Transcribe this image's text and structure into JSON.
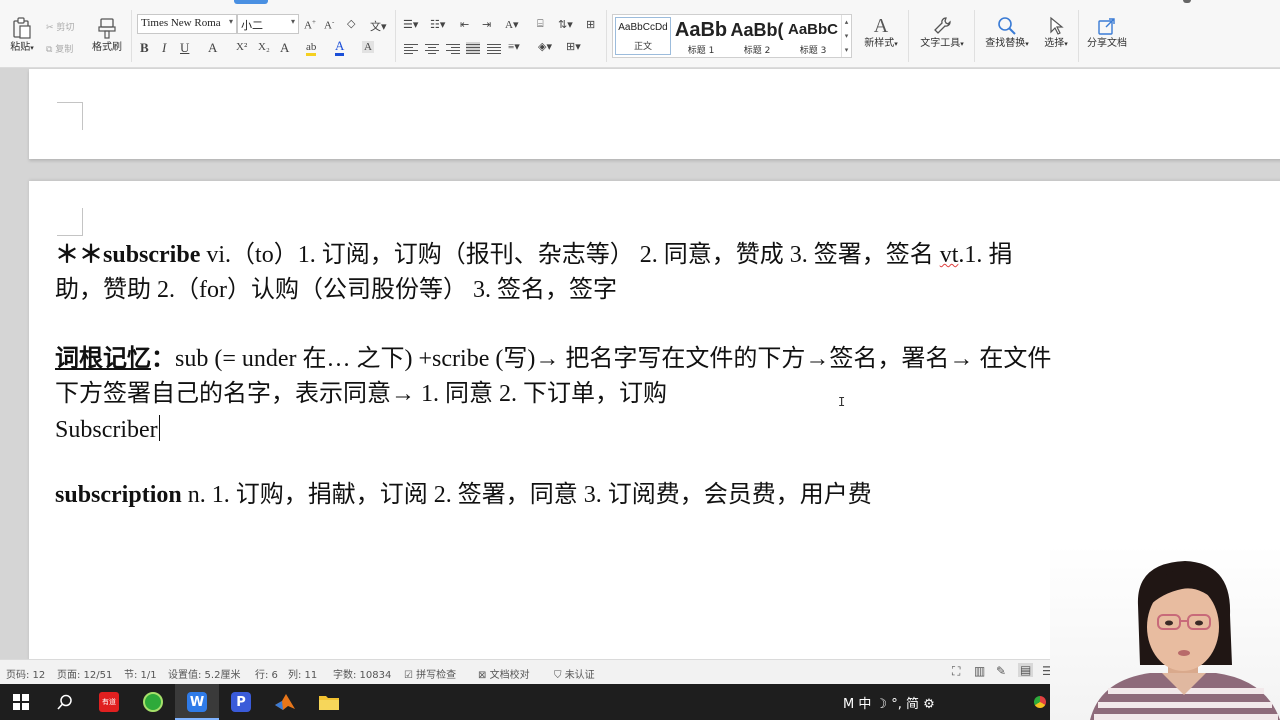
{
  "ribbon": {
    "clipboard": {
      "paste_label": "粘贴",
      "cut_label": "剪切",
      "copy_label": "复制",
      "format_painter_label": "格式刷"
    },
    "font": {
      "family": "Times New Roma",
      "size": "小二"
    },
    "styles": [
      {
        "sample": "AaBbCcDd",
        "name": "正文"
      },
      {
        "sample": "AaBb",
        "name": "标题 1"
      },
      {
        "sample": "AaBb(",
        "name": "标题 2"
      },
      {
        "sample": "AaBbC",
        "name": "标题 3"
      }
    ],
    "new_style_label": "新样式",
    "text_tools_label": "文字工具",
    "find_replace_label": "查找替换",
    "select_label": "选择",
    "share_label": "分享文档"
  },
  "document": {
    "line1": {
      "stars": "＊＊",
      "word": "subscribe",
      "rest_a": "   vi.（to）1. 订阅，订购（报刊、杂志等） 2. 同意，赞成   3. 签署，签名 ",
      "vt": "vt",
      "rest_b": ".1. 捐"
    },
    "line2": "助，赞助   2.（for）认购（公司股份等） 3. 签名，签字",
    "line3": {
      "label": "词根记忆",
      "colon": "：",
      "rest": "sub (= under  在… 之下) +scribe (写)→  把名字写在文件的下方→签名，署名→  在文件"
    },
    "line4": "下方签署自己的名字，表示同意→ 1. 同意  2. 下订单，订购",
    "line5": "Subscriber",
    "line6": {
      "word": "subscription",
      "rest": "      n. 1. 订购，捐献，订阅  2. 签署，同意  3. 订阅费，会员费，用户费"
    }
  },
  "status_bar": {
    "page_num": "页码: 12",
    "page": "页面: 12/51",
    "section": "节: 1/1",
    "setting": "设置值: 5.2厘米",
    "row": "行: 6",
    "col": "列: 11",
    "words": "字数: 10834",
    "spell": "拼写检查",
    "proof": "文档校对",
    "auth": "未认证"
  },
  "taskbar": {
    "youdao_label": "有道",
    "ime": "M 中 ☽ °, 简 ⚙"
  },
  "colors": {
    "accent": "#4a90e2",
    "taskbar_bg": "#1e1e1e",
    "squiggle": "#e04040"
  }
}
